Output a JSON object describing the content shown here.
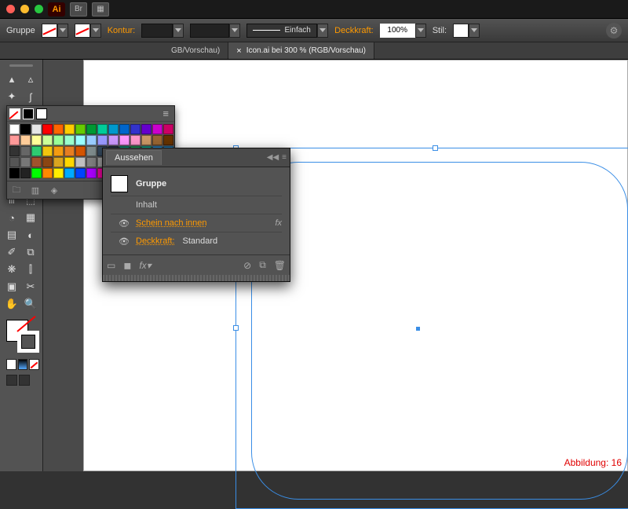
{
  "titlebar": {
    "app": "Ai",
    "bridge": "Br"
  },
  "ctrl": {
    "selection_label": "Gruppe",
    "kontur_label": "Kontur:",
    "stroke_style": "Einfach",
    "opacity_label": "Deckkraft:",
    "opacity_value": "100%",
    "stil_label": "Stil:"
  },
  "tabs": {
    "t1": "GB/Vorschau)",
    "t2": "Icon.ai bei 300 % (RGB/Vorschau)"
  },
  "appearance": {
    "panel_title": "Aussehen",
    "title": "Gruppe",
    "content": "Inhalt",
    "effect": "Schein nach innen",
    "opacity_label": "Deckkraft:",
    "opacity_value": "Standard",
    "fx": "fx"
  },
  "caption": "Abbildung: 16",
  "swatch_colors": [
    "#ffffff",
    "#000000",
    "#e6e6e6",
    "#ff0000",
    "#ff6600",
    "#ffcc00",
    "#66cc00",
    "#009933",
    "#00cc99",
    "#0099cc",
    "#0066cc",
    "#3333cc",
    "#6600cc",
    "#cc00cc",
    "#cc0066",
    "#ff9999",
    "#ffcc99",
    "#ffff99",
    "#ccff99",
    "#99ff99",
    "#99ffcc",
    "#99ffff",
    "#99ccff",
    "#9999ff",
    "#cc99ff",
    "#ff99ff",
    "#ff99cc",
    "#cc9966",
    "#996633",
    "#663300",
    "#333333",
    "#666666",
    "#2ecc71",
    "#f1c40f",
    "#f39c12",
    "#e67e22",
    "#d35400",
    "#7f8c8d",
    "#34495e",
    "#2c3e50",
    "#16a085",
    "#27ae60",
    "#1abc9c",
    "#3498db",
    "#2980b9",
    "#555555",
    "#777777",
    "#a0522d",
    "#8b4513",
    "#daa520",
    "#ffd700",
    "#c0c0c0",
    "#808080",
    "#a9a9a9",
    "#bdbdbd",
    "#d6d6d6",
    "#8fbc8f",
    "#6a5acd",
    "#4169e1",
    "#191970",
    "#000000",
    "#222222",
    "#00ff00",
    "#ff8800",
    "#ffee00",
    "#00aaff",
    "#0044ff",
    "#aa00ff",
    "#ff00aa",
    "#ff2222",
    "#884400",
    "#446600",
    "#004466",
    "#440066",
    "#660044"
  ]
}
